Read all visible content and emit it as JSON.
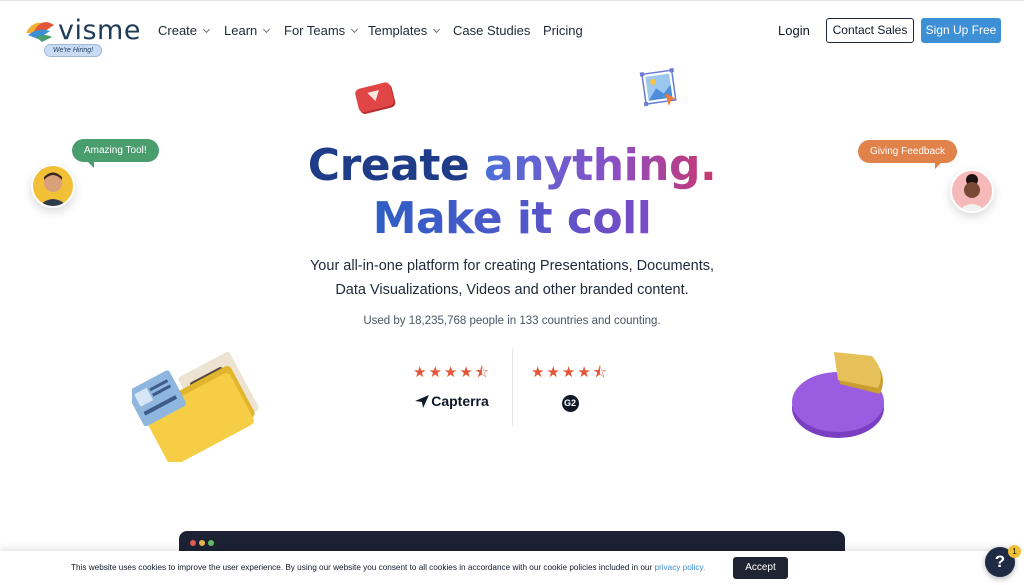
{
  "brand": {
    "name": "visme",
    "hiring_badge": "We're Hiring!"
  },
  "nav": {
    "items": [
      {
        "label": "Create",
        "dropdown": true
      },
      {
        "label": "Learn",
        "dropdown": true
      },
      {
        "label": "For Teams",
        "dropdown": true
      },
      {
        "label": "Templates",
        "dropdown": true
      },
      {
        "label": "Case Studies",
        "dropdown": false
      },
      {
        "label": "Pricing",
        "dropdown": false
      }
    ],
    "login": "Login",
    "contact_sales": "Contact Sales",
    "sign_up": "Sign Up Free"
  },
  "hero": {
    "line1_a": "Create ",
    "line1_b": "anything.",
    "line2": "Make it coll",
    "sub1": "Your all-in-one platform for creating Presentations, Documents,",
    "sub2": "Data Visualizations, Videos and other branded content.",
    "used_by": "Used by 18,235,768 people in 133 countries and counting."
  },
  "floating": {
    "bubble_left": "Amazing Tool!",
    "bubble_right": "Giving Feedback"
  },
  "ratings": [
    {
      "brand": "Capterra",
      "stars": "★★★★⯪",
      "value": 4.5
    },
    {
      "brand": "G2",
      "stars": "★★★★⯪",
      "value": 4.5
    }
  ],
  "cookie": {
    "text": "This website uses cookies to improve the user experience. By using our website you consent to all cookies in accordance with our cookie policies included in our ",
    "link": "privacy policy.",
    "accept": "Accept"
  },
  "help": {
    "label": "?",
    "badge": "1"
  },
  "colors": {
    "accent_blue": "#3d8fd6",
    "navy": "#1f3c88",
    "star": "#e2573a",
    "bubble_green": "#4a9e6e",
    "bubble_orange": "#e0824a"
  }
}
